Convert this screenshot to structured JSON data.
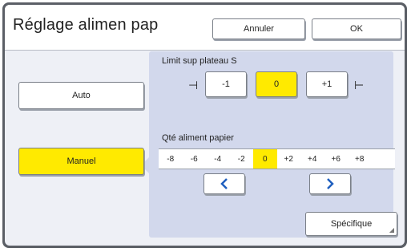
{
  "dialog": {
    "title": "Réglage alimen pap",
    "cancel_label": "Annuler",
    "ok_label": "OK"
  },
  "modes": {
    "auto_label": "Auto",
    "manual_label": "Manuel",
    "selected": "Manuel"
  },
  "plateau": {
    "label": "Limit sup plateau S",
    "options": [
      "-1",
      "0",
      "+1"
    ],
    "selected": "0"
  },
  "feed": {
    "label": "Qté aliment papier",
    "scale": [
      "-8",
      "-6",
      "-4",
      "-2",
      "0",
      "+2",
      "+4",
      "+6",
      "+8"
    ],
    "selected": "0",
    "left_icon": "chevron-left-icon",
    "right_icon": "chevron-right-icon"
  },
  "specific_label": "Spécifique",
  "colors": {
    "selected": "#ffea00",
    "panel": "#d2d8ec",
    "arrow": "#1f5fbf"
  }
}
